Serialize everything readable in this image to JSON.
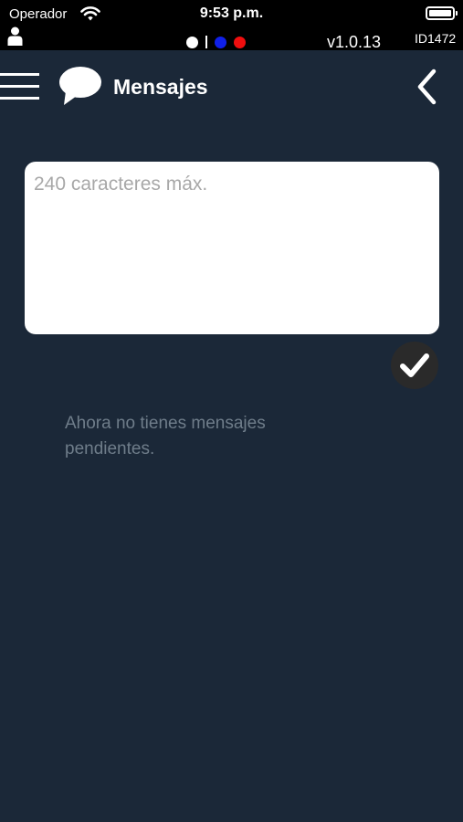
{
  "status_bar": {
    "carrier": "Operador",
    "time": "9:53 p.m.",
    "version": "v1.0.13",
    "device_id": "ID1472",
    "indicator_colors": [
      "#ffffff",
      "#1020e8",
      "#f00e0e"
    ]
  },
  "header": {
    "title": "Mensajes",
    "icons": [
      "menu-icon",
      "chat-bubble-icon",
      "chevron-left-icon"
    ]
  },
  "composer": {
    "value": "",
    "placeholder": "240 caracteres máx.",
    "send_icon": "checkmark-icon"
  },
  "messages": {
    "empty_text": "Ahora no tienes mensajes pendientes."
  },
  "colors": {
    "background": "#1b2838",
    "status_bar": "#000000"
  }
}
